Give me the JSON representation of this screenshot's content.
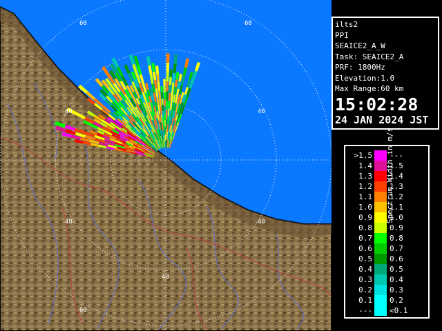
{
  "info": {
    "station": "ilts2",
    "mode": "PPI",
    "task_name": "SEAICE2_A_W",
    "task": "Task: SEAICE2_A",
    "prf": "PRF: 1800Hz",
    "elevation": "Elevation:1.0",
    "max_range": "Max Range:60 km",
    "time": "15:02:28",
    "date": "24 JAN 2024 JST"
  },
  "legend": {
    "title": "Spectrum Width in m/s",
    "rows": [
      {
        "low": ">1.5",
        "high": "---",
        "color": "#ff00ff"
      },
      {
        "low": "1.4",
        "high": "1.5",
        "color": "#e0109a"
      },
      {
        "low": "1.3",
        "high": "1.4",
        "color": "#ff0000"
      },
      {
        "low": "1.2",
        "high": "1.3",
        "color": "#ff4000"
      },
      {
        "low": "1.1",
        "high": "1.2",
        "color": "#ff8000"
      },
      {
        "low": "1.0",
        "high": "1.1",
        "color": "#ffc000"
      },
      {
        "low": "0.9",
        "high": "1.0",
        "color": "#ffff00"
      },
      {
        "low": "0.8",
        "high": "0.9",
        "color": "#c8ff00"
      },
      {
        "low": "0.7",
        "high": "0.8",
        "color": "#00ff00"
      },
      {
        "low": "0.6",
        "high": "0.7",
        "color": "#00cc00"
      },
      {
        "low": "0.5",
        "high": "0.6",
        "color": "#009900"
      },
      {
        "low": "0.4",
        "high": "0.5",
        "color": "#00a87a"
      },
      {
        "low": "0.3",
        "high": "0.4",
        "color": "#00c8b0"
      },
      {
        "low": "0.2",
        "high": "0.3",
        "color": "#00e0e0"
      },
      {
        "low": "0.1",
        "high": "0.2",
        "color": "#00ffff"
      },
      {
        "low": "---",
        "high": "<0.1",
        "color": "#00ffff"
      }
    ]
  },
  "range_labels": [
    "60",
    "60",
    "40",
    "40",
    "40",
    "40",
    "40",
    "60"
  ],
  "colors": {
    "sea": "#0a78ff",
    "land": "#8a7248",
    "coastline": "#000000",
    "rings": "#ffffff",
    "rivers": "#6070d0",
    "boundaries": "#c04040"
  }
}
